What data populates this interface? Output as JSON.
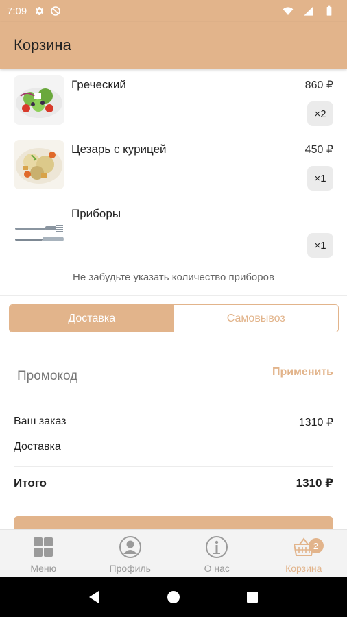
{
  "status_bar": {
    "time": "7:09"
  },
  "app_bar": {
    "title": "Корзина"
  },
  "cart": {
    "items": [
      {
        "name": "Греческий",
        "price": "860 ₽",
        "qty": "×2",
        "image": "greek-salad-photo"
      },
      {
        "name": "Цезарь с курицей",
        "price": "450 ₽",
        "qty": "×1",
        "image": "caesar-salad-photo"
      },
      {
        "name": "Приборы",
        "price": "",
        "qty": "×1",
        "image": "cutlery-photo"
      }
    ],
    "hint": "Не забудьте указать количество приборов"
  },
  "delivery_toggle": {
    "options": [
      "Доставка",
      "Самовывоз"
    ],
    "selected": "Доставка"
  },
  "promo": {
    "placeholder": "Промокод",
    "value": "",
    "apply_label": "Применить"
  },
  "summary": {
    "order_label": "Ваш заказ",
    "order_value": "1310 ₽",
    "delivery_label": "Доставка",
    "delivery_value": "",
    "total_label": "Итого",
    "total_value": "1310 ₽"
  },
  "bottom_nav": {
    "items": [
      {
        "label": "Меню",
        "icon": "grid-icon"
      },
      {
        "label": "Профиль",
        "icon": "profile-icon"
      },
      {
        "label": "О нас",
        "icon": "info-icon"
      },
      {
        "label": "Корзина",
        "icon": "basket-icon"
      }
    ],
    "active": "Корзина",
    "cart_badge": "2"
  },
  "colors": {
    "accent": "#e2b48b",
    "muted": "#9a9a9a",
    "qty_bg": "#ebebeb"
  }
}
